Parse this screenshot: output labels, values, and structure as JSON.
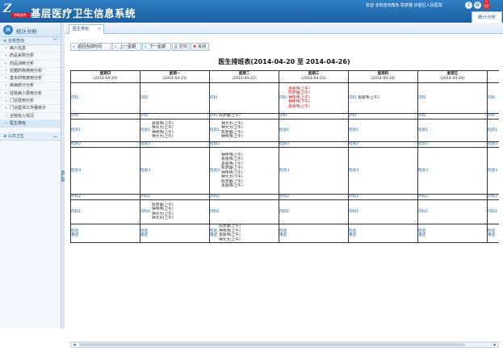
{
  "app": {
    "logo_mark": "Z",
    "logo_sub": "中联软件",
    "title": "基层医疗卫生信息系统"
  },
  "header": {
    "welcome": "欢迎  全院查询角色  陈梦璇  拱墅区人民医院",
    "top_tab": "统计分析",
    "badge": "0",
    "icons": [
      "help-icon",
      "gear-icon",
      "power-icon"
    ]
  },
  "sidebar": {
    "title": "统计分析",
    "group1": "全院查询",
    "items": [
      "病人信息",
      "药品采购分析",
      "药品消耗分析",
      "抗菌药物使用分析",
      "基本药物使用分析",
      "疾病统计分析",
      "住院病人费用分析",
      "门诊费用分析",
      "门诊医师工作量统计",
      "全院收入情况",
      "医生排班"
    ],
    "group2": "公共卫生"
  },
  "tabs": {
    "active": "医生排班"
  },
  "toolbar": {
    "current_week": "返回当前时间",
    "prev_week": "上一星期",
    "next_week": "下一星期",
    "print": "打印",
    "close": "关闭"
  },
  "schedule": {
    "title": "医生排班表(2014-04-20 至 2014-04-26)",
    "days": [
      {
        "name": "星期日",
        "date": "(2014-04-20)"
      },
      {
        "name": "星期一",
        "date": "(2014-04-21)"
      },
      {
        "name": "星期二",
        "date": "(2014-04-22)"
      },
      {
        "name": "星期三",
        "date": "(2014-04-23)"
      },
      {
        "name": "星期四",
        "date": "(2014-04-24)"
      },
      {
        "name": "星期五",
        "date": "(2014-04-24)"
      },
      {
        "name": "",
        "date": ""
      }
    ],
    "rows": [
      {
        "h": 38,
        "cells": [
          {
            "dept": "内科",
            "docs": []
          },
          {
            "dept": "内科",
            "docs": []
          },
          {
            "dept": "内科",
            "docs": []
          },
          {
            "dept": "内科",
            "docs": [
              "袁丽伟(上午)",
              "陈梦璇(上午)",
              "钟伟伟(上午)",
              "钟伟伟(下午)",
              "袁丽伟(上午)"
            ],
            "red": true
          },
          {
            "dept": "内科",
            "docs": [
              "袁丽伟(上午)"
            ]
          },
          {
            "dept": "内科",
            "docs": []
          },
          {
            "dept": "内科",
            "docs": []
          }
        ]
      },
      {
        "h": 7,
        "cells": [
          {
            "dept": "外科",
            "docs": []
          },
          {
            "dept": "外科",
            "docs": []
          },
          {
            "dept": "外科",
            "docs": [
              "陈梦璇(上午)"
            ]
          },
          {
            "dept": "外科",
            "docs": []
          },
          {
            "dept": "外科",
            "docs": []
          },
          {
            "dept": "外科",
            "docs": []
          },
          {
            "dept": "外科",
            "docs": []
          }
        ]
      },
      {
        "h": 28,
        "cells": [
          {
            "dept": "检验1",
            "docs": []
          },
          {
            "dept": "检验1",
            "docs": [
              "袁丽伟(上午)",
              "钟大大(上午)",
              "钟伟伟(上午)",
              "钟大大(上午)"
            ]
          },
          {
            "dept": "检验1",
            "docs": [
              "钟大大(上午)",
              "钟大大(上午)",
              "陈梦璇(上午)",
              "钟伟伟(上午)"
            ]
          },
          {
            "dept": "检验1",
            "docs": []
          },
          {
            "dept": "检验1",
            "docs": []
          },
          {
            "dept": "检验1",
            "docs": []
          },
          {
            "dept": "检验1",
            "docs": []
          }
        ]
      },
      {
        "h": 7,
        "cells": [
          {
            "dept": "检验2",
            "docs": []
          },
          {
            "dept": "检验2",
            "docs": []
          },
          {
            "dept": "检验2",
            "docs": []
          },
          {
            "dept": "检验2",
            "docs": []
          },
          {
            "dept": "检验2",
            "docs": []
          },
          {
            "dept": "检验2",
            "docs": []
          },
          {
            "dept": "检验2",
            "docs": []
          }
        ]
      },
      {
        "h": 58,
        "cells": [
          {
            "dept": "检验3",
            "docs": []
          },
          {
            "dept": "检验3",
            "docs": []
          },
          {
            "dept": "检验3",
            "docs": [
              "钟伟伟(上午)",
              "袁丽伟(上午)",
              "袁丽伟(上午)",
              "陈梦璇(上午)",
              "钟伟伟(下午)",
              "钟大大(下午)",
              "陈梦璇(上午)",
              "袁丽伟(上午)"
            ]
          },
          {
            "dept": "检验3",
            "docs": []
          },
          {
            "dept": "检验3",
            "docs": []
          },
          {
            "dept": "检验3",
            "docs": []
          },
          {
            "dept": "检验3",
            "docs": []
          }
        ]
      },
      {
        "h": 7,
        "cells": [
          {
            "dept": "外科2",
            "docs": []
          },
          {
            "dept": "外科2",
            "docs": []
          },
          {
            "dept": "外科2",
            "docs": []
          },
          {
            "dept": "外科2",
            "docs": []
          },
          {
            "dept": "外科2",
            "docs": []
          },
          {
            "dept": "外科2",
            "docs": []
          },
          {
            "dept": "外科2",
            "docs": []
          }
        ]
      },
      {
        "h": 30,
        "cells": [
          {
            "dept": "内科1",
            "docs": []
          },
          {
            "dept": "内科1",
            "docs": [
              "陈梦璇(上午)",
              "钟伟伟(上午)",
              "钟大大(上午)",
              "钟大大(上午)"
            ]
          },
          {
            "dept": "内科1",
            "docs": []
          },
          {
            "dept": "内科1",
            "docs": []
          },
          {
            "dept": "内科1",
            "docs": []
          },
          {
            "dept": "内科1",
            "docs": []
          },
          {
            "dept": "内科1",
            "docs": []
          }
        ]
      },
      {
        "h": 22,
        "cells": [
          {
            "dept": "检验\n重症",
            "docs": []
          },
          {
            "dept": "检验\n重症",
            "docs": []
          },
          {
            "dept": "检验\n重症",
            "docs": [
              "陈梦璇(上午)",
              "钟伟伟(上午)",
              "袁丽伟(上午)",
              "钟大大(上午)"
            ]
          },
          {
            "dept": "检验\n重症",
            "docs": []
          },
          {
            "dept": "检验\n重症",
            "docs": []
          },
          {
            "dept": "检验\n重症",
            "docs": []
          },
          {
            "dept": "检验\n重症",
            "docs": []
          }
        ]
      }
    ]
  }
}
